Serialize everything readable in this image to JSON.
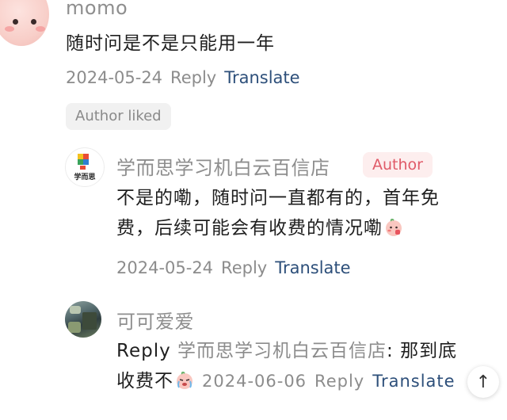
{
  "comment": {
    "username": "momo",
    "text": "随时问是不是只能用一年",
    "date": "2024-05-24",
    "reply": "Reply",
    "translate": "Translate",
    "author_liked": "Author liked"
  },
  "author_reply": {
    "username": "学而思学习机白云百信店",
    "badge": "Author",
    "text_line1": "不是的嘞，随时问一直都有的，首年免",
    "text_line2": "费，后续可能会有收费的情况嘞",
    "date": "2024-05-24",
    "translate": "Translate",
    "logo_text": "学而思"
  },
  "sub_reply": {
    "username": "可可爱爱",
    "reply_prefix": "Reply",
    "reply_to": "学而思学习机白云百信店",
    "text_line1": ": 那到底",
    "text_line2": "收费不",
    "date": "2024-06-06",
    "reply": "Reply",
    "translate": "Translate"
  },
  "scroll_top_icon": "↑",
  "colors": {
    "link": "#2d4f7a",
    "author_badge": "#e05a68",
    "meta": "#8c8c8c"
  }
}
